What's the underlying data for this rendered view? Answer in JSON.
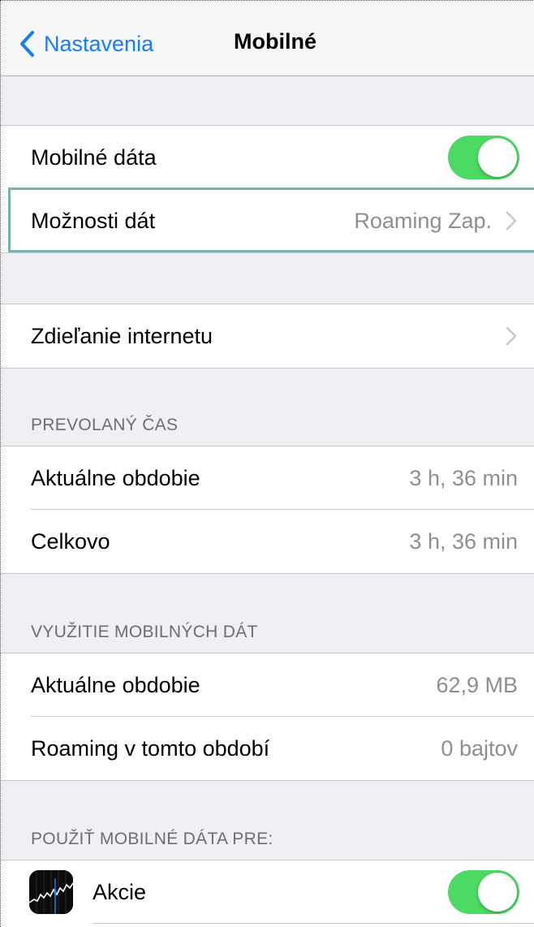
{
  "navbar": {
    "back_label": "Nastavenia",
    "title": "Mobilné"
  },
  "group1": {
    "mobile_data_label": "Mobilné dáta",
    "mobile_data_on": true,
    "data_options_label": "Možnosti dát",
    "data_options_value": "Roaming Zap."
  },
  "group2": {
    "hotspot_label": "Zdieľanie internetu"
  },
  "call_time": {
    "header": "PREVOLANÝ ČAS",
    "current_label": "Aktuálne obdobie",
    "current_value": "3 h, 36 min",
    "total_label": "Celkovo",
    "total_value": "3 h, 36 min"
  },
  "data_usage": {
    "header": "VYUŽITIE MOBILNÝCH DÁT",
    "current_label": "Aktuálne obdobie",
    "current_value": "62,9 MB",
    "roaming_label": "Roaming v tomto období",
    "roaming_value": "0 bajtov"
  },
  "apps": {
    "header": "POUŽIŤ MOBILNÉ DÁTA PRE:",
    "items": [
      {
        "label": "Akcie",
        "icon": "stocks-app-icon",
        "enabled": true
      }
    ]
  },
  "colors": {
    "accent": "#157efb",
    "toggle_on": "#4cd964",
    "background": "#efeff4",
    "secondary_text": "#8e8e93"
  }
}
